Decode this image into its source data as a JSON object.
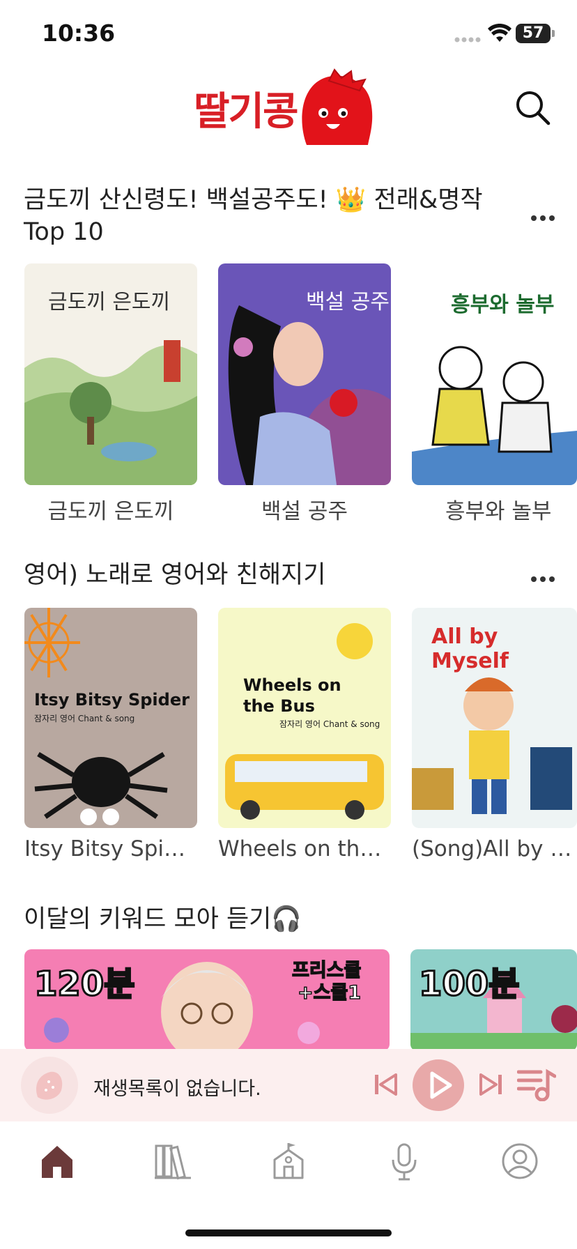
{
  "status_bar": {
    "time": "10:36",
    "battery": "57"
  },
  "header": {
    "logo_text": "딸기콩"
  },
  "sections": [
    {
      "title": "금도끼 산신령도! 백설공주도! 👑 전래&명작 Top 10",
      "items": [
        {
          "cover_title": "금도끼 은도끼",
          "label": "금도끼 은도끼"
        },
        {
          "cover_title": "백설 공주",
          "label": "백설 공주"
        },
        {
          "cover_title": "흥부와 놀부",
          "label": "흥부와 놀부"
        }
      ]
    },
    {
      "title": "영어) 노래로 영어와 친해지기",
      "items": [
        {
          "cover_title": "Itsy Bitsy Spider",
          "cover_sub": "잠자리 영어 Chant & song",
          "label": "Itsy Bitsy Spider"
        },
        {
          "cover_title": "Wheels on the Bus",
          "cover_sub": "잠자리 영어 Chant & song",
          "label": "Wheels on the B..."
        },
        {
          "cover_title": "All by Myself",
          "label": "(Song)All by My..."
        }
      ]
    },
    {
      "title": "이달의 키워드 모아 듣기🎧",
      "banners": [
        {
          "duration": "120분",
          "tag_line1": "프리스쿨",
          "tag_line2": "+스쿨1"
        },
        {
          "duration": "100분"
        }
      ]
    }
  ],
  "player": {
    "status_text": "재생목록이 없습니다."
  },
  "tabs": [
    {
      "icon": "home-icon",
      "active": true
    },
    {
      "icon": "books-icon",
      "active": false
    },
    {
      "icon": "school-icon",
      "active": false
    },
    {
      "icon": "microphone-icon",
      "active": false
    },
    {
      "icon": "profile-icon",
      "active": false
    }
  ],
  "colors": {
    "brand": "#d81f26",
    "tab_active": "#6b3a3a",
    "tab_inactive": "#9a9a9a",
    "player_bg": "#fcefef",
    "player_accent": "#e8a9a9"
  }
}
